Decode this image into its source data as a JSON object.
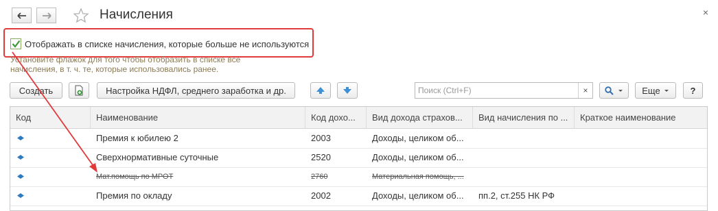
{
  "window": {
    "title": "Начисления",
    "close_glyph": "×"
  },
  "checkbox": {
    "label": "Отображать в списке начисления, которые больше не используются",
    "checked": true
  },
  "hint": "Установите флажок для того чтобы отобразить в списке все начисления, в т. ч. те, которые использовались ранее.",
  "toolbar": {
    "create_label": "Создать",
    "settings_label": "Настройка НДФЛ, среднего заработка и др.",
    "more_label": "Еще",
    "help_label": "?"
  },
  "search": {
    "placeholder": "Поиск (Ctrl+F)",
    "clear_glyph": "×"
  },
  "table": {
    "columns": [
      "Код",
      "Наименование",
      "Код дохо...",
      "Вид дохода страхов...",
      "Вид начисления по ...",
      "Краткое наименование"
    ],
    "rows": [
      {
        "code": "",
        "name": "Премия к юбилею 2",
        "income_code": "2003",
        "insurance": "Доходы, целиком об...",
        "accrual_type": "",
        "short_name": "",
        "archived": false
      },
      {
        "code": "",
        "name": "Сверхнормативные суточные",
        "income_code": "2520",
        "insurance": "Доходы, целиком об...",
        "accrual_type": "",
        "short_name": "",
        "archived": false
      },
      {
        "code": "",
        "name": "Мат.помощь по МРОТ",
        "income_code": "2760",
        "insurance": "Материальная помощь, ...",
        "accrual_type": "",
        "short_name": "",
        "archived": true
      },
      {
        "code": "",
        "name": "Премия по окладу",
        "income_code": "2002",
        "insurance": "Доходы, целиком об...",
        "accrual_type": "пп.2, ст.255 НК РФ",
        "short_name": "",
        "archived": false
      }
    ]
  },
  "colors": {
    "accent_red": "#e03a3a",
    "check_green": "#3a9a3a",
    "row_icon": "#2f7bbf",
    "move_button_blue": "#3d8fd6"
  },
  "icons": [
    "back-arrow-icon",
    "forward-arrow-icon",
    "star-icon",
    "close-icon",
    "add-copy-icon",
    "move-up-icon",
    "move-down-icon",
    "search-icon",
    "chevron-down-icon",
    "row-element-icon"
  ]
}
